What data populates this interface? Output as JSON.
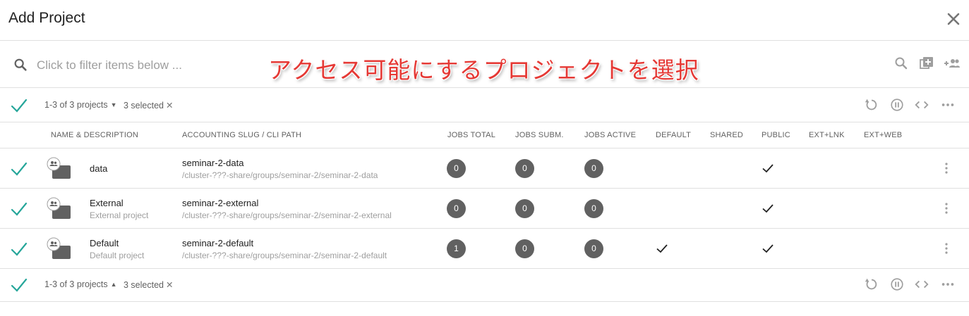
{
  "header": {
    "title": "Add Project"
  },
  "filter": {
    "placeholder": "Click to filter items below ..."
  },
  "overlay_text": "アクセス可能にするプロジェクトを選択",
  "toolbar_icons": [
    "search-icon",
    "add-box-icon",
    "add-group-icon"
  ],
  "summary": {
    "count_text": "1-3 of 3 projects",
    "selected_text": "3 selected",
    "actions": [
      "refresh-icon",
      "pause-icon",
      "code-icon",
      "more-horiz-icon"
    ]
  },
  "columns": {
    "name": "NAME & DESCRIPTION",
    "slug": "ACCOUNTING SLUG / CLI PATH",
    "jobs_total": "JOBS TOTAL",
    "jobs_subm": "JOBS SUBM.",
    "jobs_active": "JOBS ACTIVE",
    "default": "DEFAULT",
    "shared": "SHARED",
    "public": "PUBLIC",
    "ext_lnk": "EXT+LNK",
    "ext_web": "EXT+WEB"
  },
  "rows": [
    {
      "name": "data",
      "description": "",
      "slug": "seminar-2-data",
      "path": "/cluster-???-share/groups/seminar-2/seminar-2-data",
      "jobs_total": "0",
      "jobs_subm": "0",
      "jobs_active": "0",
      "default": false,
      "shared": false,
      "public": true,
      "ext_lnk": false,
      "ext_web": false,
      "selected": true
    },
    {
      "name": "External",
      "description": "External project",
      "slug": "seminar-2-external",
      "path": "/cluster-???-share/groups/seminar-2/seminar-2-external",
      "jobs_total": "0",
      "jobs_subm": "0",
      "jobs_active": "0",
      "default": false,
      "shared": false,
      "public": true,
      "ext_lnk": false,
      "ext_web": false,
      "selected": true
    },
    {
      "name": "Default",
      "description": "Default project",
      "slug": "seminar-2-default",
      "path": "/cluster-???-share/groups/seminar-2/seminar-2-default",
      "jobs_total": "1",
      "jobs_subm": "0",
      "jobs_active": "0",
      "default": true,
      "shared": false,
      "public": true,
      "ext_lnk": false,
      "ext_web": false,
      "selected": true
    }
  ],
  "colors": {
    "accent": "#26a69a",
    "badge": "#616161",
    "overlay": "#e53935"
  }
}
